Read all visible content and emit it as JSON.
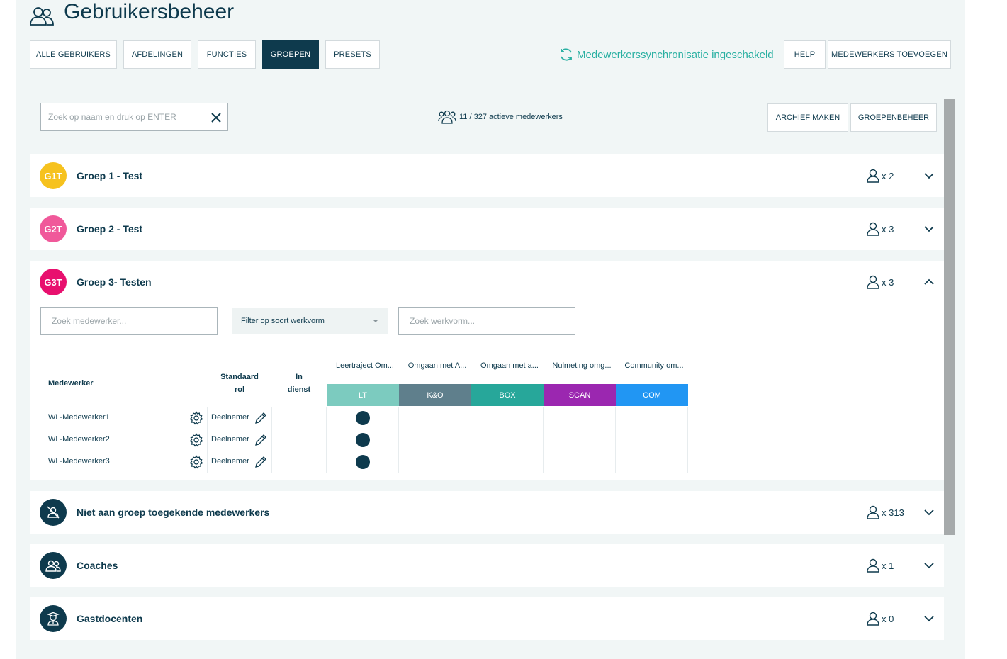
{
  "header": {
    "title": "Gebruikersbeheer",
    "title_icon": "users-icon"
  },
  "tabs": [
    {
      "label": "ALLE GEBRUIKERS",
      "active": false
    },
    {
      "label": "AFDELINGEN",
      "active": false
    },
    {
      "label": "FUNCTIES",
      "active": false
    },
    {
      "label": "GROEPEN",
      "active": true
    },
    {
      "label": "PRESETS",
      "active": false
    }
  ],
  "sync": {
    "label": "Medewerkerssynchronisatie ingeschakeld",
    "icon": "sync-icon",
    "color": "#2ab0a2"
  },
  "actions": {
    "help": "HELP",
    "add_employees": "MEDEWERKERS TOEVOEGEN"
  },
  "search": {
    "placeholder": "Zoek op naam en druk op ENTER",
    "value": ""
  },
  "active_count": "11 / 327 actieve medewerkers",
  "buttons": {
    "archive": "ARCHIEF MAKEN",
    "group_management": "GROEPENBEHEER"
  },
  "groups": [
    {
      "initials": "G1T",
      "name": "Groep 1 - Test",
      "count": "x 2",
      "color": "#f6c21e",
      "expanded": false
    },
    {
      "initials": "G2T",
      "name": "Groep 2 - Test",
      "count": "x 3",
      "color": "#f0599a",
      "expanded": false
    },
    {
      "initials": "G3T",
      "name": "Groep 3- Testen",
      "count": "x 3",
      "color": "#e8106e",
      "expanded": true
    },
    {
      "initials": "",
      "name": "Niet aan groep toegekende medewerkers",
      "count": "x 313",
      "icon": "user-slash-icon",
      "expanded": false
    },
    {
      "initials": "",
      "name": "Coaches",
      "count": "x 1",
      "icon": "users-icon",
      "expanded": false
    },
    {
      "initials": "",
      "name": "Gastdocenten",
      "count": "x 0",
      "icon": "teacher-icon",
      "expanded": false
    }
  ],
  "expanded": {
    "employee_search_placeholder": "Zoek medewerker...",
    "filter_label": "Filter op soort werkvorm",
    "werkvorm_search_placeholder": "Zoek werkvorm...",
    "columns": {
      "employee": "Medewerker",
      "role_line1": "Standaard",
      "role_line2": "rol",
      "service_line1": "In",
      "service_line2": "dienst"
    },
    "werkvormen": [
      {
        "label": "Leertraject Om...",
        "badge": "LT",
        "color": "#7ccbbf"
      },
      {
        "label": "Omgaan met A...",
        "badge": "K&O",
        "color": "#5f7f8c"
      },
      {
        "label": "Omgaan met a...",
        "badge": "BOX",
        "color": "#27a79a"
      },
      {
        "label": "Nulmeting omg...",
        "badge": "SCAN",
        "color": "#9b27b0"
      },
      {
        "label": "Community om...",
        "badge": "COM",
        "color": "#2196f3"
      }
    ],
    "rows": [
      {
        "name": "WL-Medewerker1",
        "role": "Deelnemer"
      },
      {
        "name": "WL-Medewerker2",
        "role": "Deelnemer"
      },
      {
        "name": "WL-Medewerker3",
        "role": "Deelnemer"
      }
    ]
  },
  "colors": {
    "primary": "#0e3a4d",
    "page_bg": "#f1f6f6",
    "accent": "#2ab0a2"
  }
}
